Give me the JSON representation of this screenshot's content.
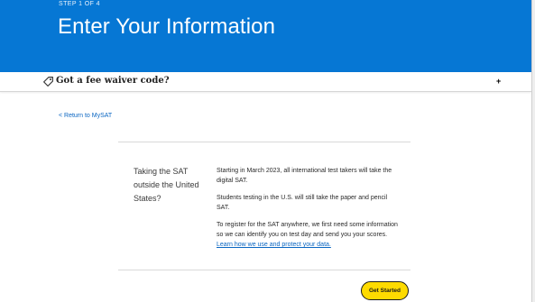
{
  "header": {
    "step": "STEP 1 OF 4",
    "title": "Enter Your Information"
  },
  "fee_waiver": {
    "label": "Got a fee waiver code?",
    "icon": "tag-icon",
    "expand_icon": "plus-icon",
    "expand_glyph": "+"
  },
  "nav": {
    "return_link": "< Return to MySAT"
  },
  "main": {
    "side_heading": "Taking the SAT outside the United States?",
    "paragraph_1": "Starting in March 2023, all international test takers will take the digital SAT.",
    "paragraph_2": "Students testing in the U.S. will still take the paper and pencil SAT.",
    "paragraph_3_text": "To register for the SAT anywhere, we first need some information so we can identify you on test day and send you your scores. ",
    "paragraph_3_link": "Learn how we use and protect your data.",
    "cta_label": "Get Started"
  },
  "colors": {
    "header_bg": "#0677d4",
    "link": "#0a66c2",
    "cta_bg": "#fedb00"
  }
}
